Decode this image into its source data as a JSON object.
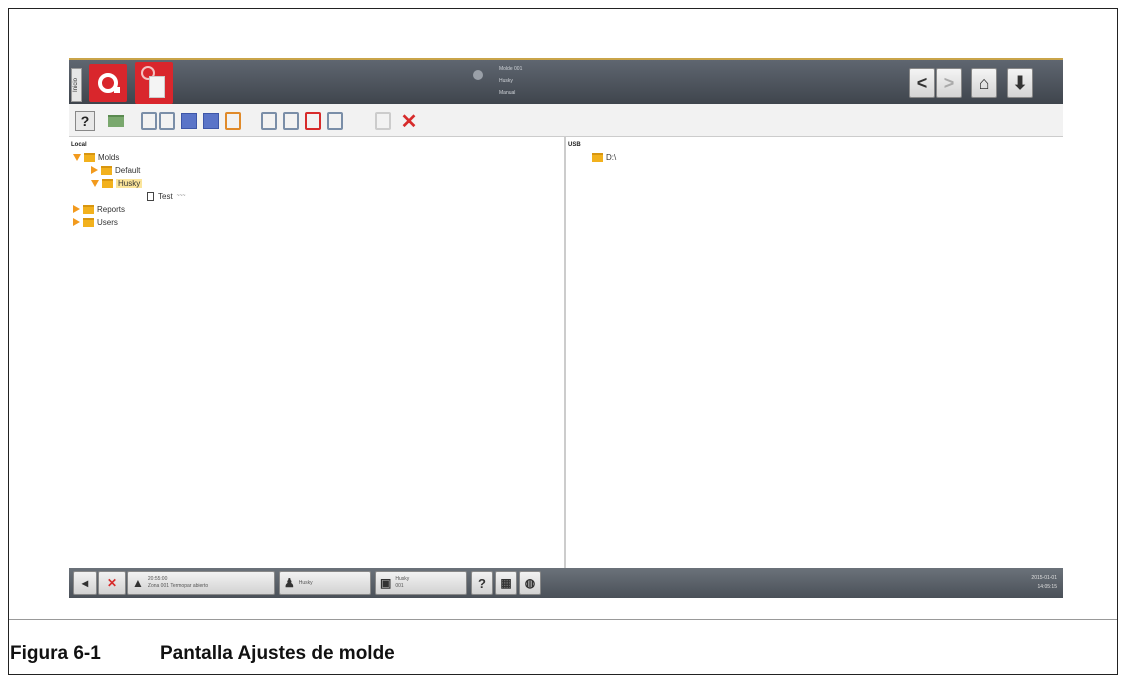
{
  "screen": {
    "left_tab_label": "Inicio",
    "status": {
      "line1": "Molde 001",
      "line2": "Husky",
      "line3": "Manual"
    },
    "nav": {
      "back": "<",
      "forward": ">",
      "home": "⌂",
      "logout": "⬇"
    },
    "toolbar": {
      "help": "?",
      "delete": "✕"
    },
    "left_panel": {
      "header": "Local",
      "tree": [
        {
          "label": "Molds"
        },
        {
          "label": "Default"
        },
        {
          "label": "Husky"
        },
        {
          "label": "Test"
        },
        {
          "label": "Reports"
        },
        {
          "label": "Users"
        }
      ],
      "test_suffix": "~~~"
    },
    "right_panel": {
      "header": "USB",
      "tree": [
        {
          "label": "D:\\"
        }
      ]
    },
    "statusbar": {
      "alarm_time": "20:55:00",
      "alarm_text": "Zona 001 Termopar abierto",
      "user_text": "Husky",
      "mold_name": "Husky",
      "mold_sub": "001",
      "help": "?",
      "date": "2015-01-01",
      "time": "14:05:15"
    }
  },
  "caption": {
    "number": "Figura 6-1",
    "title": "Pantalla Ajustes de molde"
  },
  "colors": {
    "accent_red": "#d9262c",
    "folder_yellow": "#f2b11d",
    "caret_orange": "#f29a1d",
    "selection": "#fbe59b"
  }
}
